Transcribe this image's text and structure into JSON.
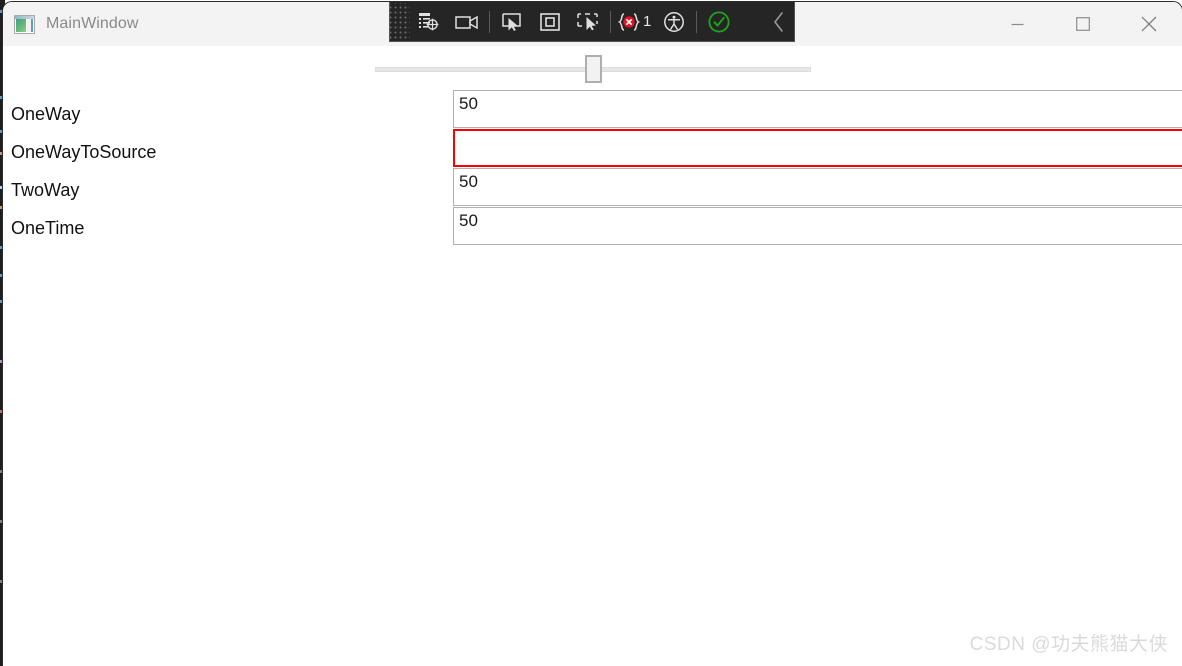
{
  "window": {
    "title": "MainWindow",
    "app_icon": "window-icon",
    "caption": {
      "minimize": "minimize-icon",
      "maximize": "maximize-icon",
      "close": "close-icon"
    }
  },
  "vs_toolbar": {
    "grip": "drag-grip",
    "buttons": [
      {
        "name": "go-to-live-visual-tree-icon",
        "title": "Go to Live Visual Tree"
      },
      {
        "name": "live-preview-camera-icon",
        "title": "Live Preview"
      },
      {
        "name": "select-element-icon",
        "title": "Select Element"
      },
      {
        "name": "display-layout-adorner-icon",
        "title": "Display Layout Adorners"
      },
      {
        "name": "track-focused-element-icon",
        "title": "Track Focused Element"
      }
    ],
    "error_badge": {
      "icon": "xaml-binding-failure-icon",
      "count": "1"
    },
    "accessibility": {
      "icon": "accessibility-icon"
    },
    "status": {
      "icon": "hot-reload-success-icon"
    },
    "collapse": {
      "icon": "chevron-left-icon"
    }
  },
  "slider": {
    "name": "value-slider",
    "min": 0,
    "max": 100,
    "value": 50
  },
  "bindings": {
    "rows": [
      {
        "label": "OneWay",
        "value": "50",
        "error": false
      },
      {
        "label": "OneWayToSource",
        "value": "",
        "error": true
      },
      {
        "label": "TwoWay",
        "value": "50",
        "error": false
      },
      {
        "label": "OneTime",
        "value": "50",
        "error": false
      }
    ]
  },
  "watermark": {
    "text": "CSDN @功夫熊猫大侠"
  },
  "colors": {
    "titlebar_bg": "#f3f3f3",
    "toolbar_bg": "#252526",
    "error_border": "#ff0000",
    "textbox_border": "#aeb2b7",
    "slider_track": "#e7e7e7",
    "watermark": "#dadada",
    "status_green": "#20a020"
  }
}
